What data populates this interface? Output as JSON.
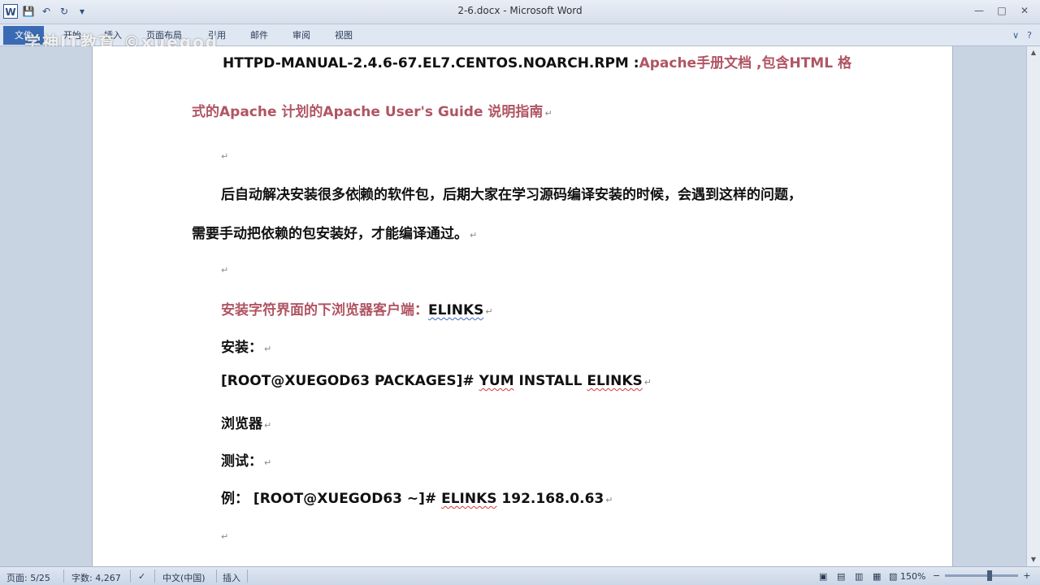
{
  "window": {
    "title": "2-6.docx - Microsoft Word",
    "app_icon": "W"
  },
  "ribbon": {
    "tabs": [
      "文件",
      "开始",
      "插入",
      "页面布局",
      "引用",
      "邮件",
      "审阅",
      "视图"
    ]
  },
  "watermark": "学神IT教育 ©xuegod",
  "document": {
    "line1": "HTTPD-MANUAL-2.4.6-67.EL7.CENTOS.NOARCH.RPM :",
    "line1_accent": "Apache手册文档 ,包含HTML 格",
    "line2": "式的Apache 计划的Apache User's Guide 说明指南",
    "line3_a": "后自动解决安装很多依",
    "line3_b": "赖的软件包，后期大家在学习源码编译安装的时候，会遇到这样的问题，",
    "line4": "需要手动把依赖的包安装好，才能编译通过。",
    "line5_accent": "安装字符界面的下浏览器客户端：",
    "line5_b": "ELINKS",
    "line6": "安装：",
    "line7_a": "[ROOT@XUEGOD63 PACKAGES]# ",
    "line7_b": "YUM",
    "line7_c": " INSTALL ",
    "line7_d": "ELINKS",
    "line8": "浏览器",
    "line9": "测试：",
    "line10_a": "例：  [ROOT@XUEGOD63 ~]# ",
    "line10_b": "ELINKS",
    "line10_c": " 192.168.0.63",
    "para_mark": "↵"
  },
  "statusbar": {
    "page": "页面: 5/25",
    "words": "字数: 4,267",
    "language": "中文(中国)",
    "mode": "插入",
    "zoom": "150%",
    "zoom_level": 150
  }
}
